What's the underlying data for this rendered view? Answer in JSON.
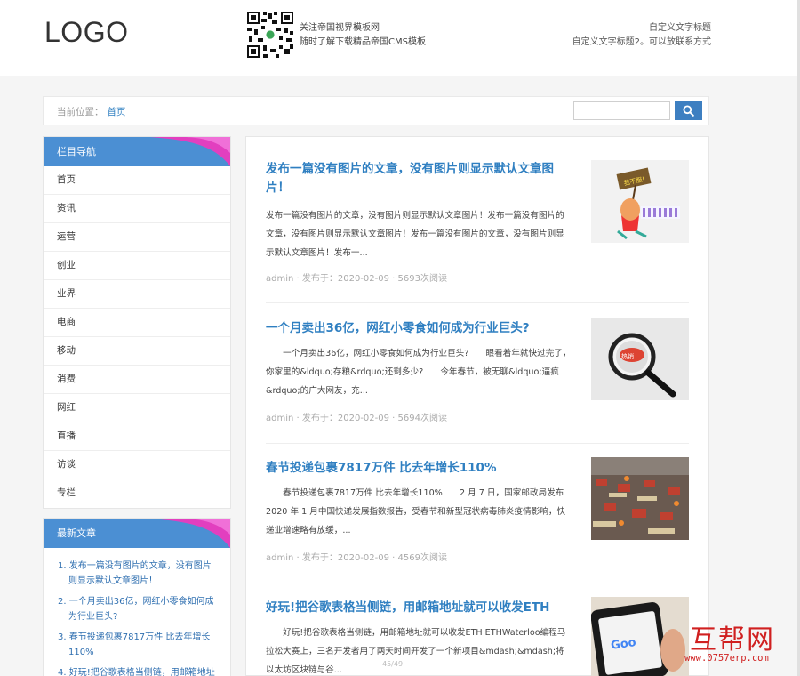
{
  "header": {
    "logo": "LOGO",
    "qr_line1": "关注帝国视界模板网",
    "qr_line2": "随时了解下载精品帝国CMS模板",
    "right_line1": "自定义文字标题",
    "right_line2": "自定义文字标题2。可以放联系方式"
  },
  "breadcrumb": {
    "label": "当前位置：",
    "home": "首页"
  },
  "search": {
    "placeholder": "",
    "value": ""
  },
  "nav_panel": {
    "title": "栏目导航",
    "items": [
      "首页",
      "资讯",
      "运营",
      "创业",
      "业界",
      "电商",
      "移动",
      "消费",
      "网红",
      "直播",
      "访谈",
      "专栏"
    ]
  },
  "recent_panel": {
    "title": "最新文章",
    "items": [
      "1. 发布一篇没有图片的文章，没有图片则显示默认文章图片！",
      "2. 一个月卖出36亿，网红小零食如何成为行业巨头?",
      "3. 春节投递包裹7817万件 比去年增长110%",
      "4. 好玩!把谷歌表格当侧链，用邮箱地址"
    ]
  },
  "articles": [
    {
      "title": "发布一篇没有图片的文章，没有图片则显示默认文章图片！",
      "summary": "发布一篇没有图片的文章，没有图片则显示默认文章图片！发布一篇没有图片的文章，没有图片则显示默认文章图片！发布一篇没有图片的文章，没有图片则显示默认文章图片！发布一...",
      "meta": "admin · 发布于：2020-02-09 · 5693次阅读"
    },
    {
      "title": "一个月卖出36亿，网红小零食如何成为行业巨头?",
      "summary": "　　一个月卖出36亿，网红小零食如何成为行业巨头?　　眼看着年就快过完了，你家里的&ldquo;存粮&rdquo;还剩多少?　　今年春节，被无聊&ldquo;逼疯&rdquo;的广大网友，充...",
      "meta": "admin · 发布于：2020-02-09 · 5694次阅读"
    },
    {
      "title": "春节投递包裹7817万件 比去年增长110%",
      "summary": "　　春节投递包裹7817万件 比去年增长110%　　2 月 7 日，国家邮政局发布 2020 年 1 月中国快递发展指数报告，受春节和新型冠状病毒肺炎疫情影响，快递业增速略有放缓，...",
      "meta": "admin · 发布于：2020-02-09 · 4569次阅读"
    },
    {
      "title": "好玩!把谷歌表格当侧链，用邮箱地址就可以收发ETH",
      "summary": "　　好玩!把谷歌表格当侧链，用邮箱地址就可以收发ETH ETHWaterloo编程马拉松大赛上，三名开发者用了两天时间开发了一个新项目&mdash;&mdash;将以太坊区块链与谷...",
      "meta": ""
    }
  ],
  "watermark": {
    "title": "互帮网",
    "url": "www.0757erp.com"
  },
  "page_number": "45/49",
  "colors": {
    "accent": "#2f7fc1",
    "panel_head": "#4b8fd3",
    "swoosh": "#e23fbf",
    "watermark": "#d02020"
  }
}
